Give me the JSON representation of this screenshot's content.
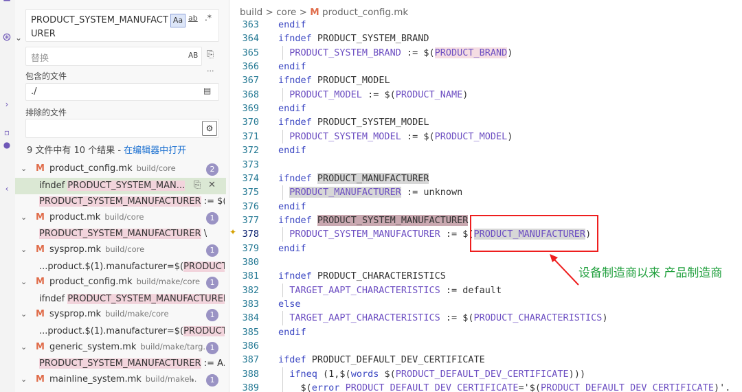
{
  "search": {
    "query": "PRODUCT_SYSTEM_MANUFACTURER",
    "option_case": "Aa",
    "option_word": "ab",
    "option_regex": ".*",
    "replace_placeholder": "替换",
    "replace_option": "AB",
    "include_label": "包含的文件",
    "include_value": "./",
    "exclude_label": "排除的文件",
    "exclude_value": "",
    "summary": "9 文件中有 10 个结果 - ",
    "open_in_editor": "在编辑器中打开",
    "more": "···"
  },
  "results": [
    {
      "file": "product_config.mk",
      "path": "build/core",
      "count": "2",
      "matches": [
        {
          "pre": "ifndef ",
          "hit": "PRODUCT_SYSTEM_MAN...",
          "post": ""
        },
        {
          "pre": "",
          "hit": "PRODUCT_SYSTEM_MANUFACTURER",
          "post": " := $(..."
        }
      ]
    },
    {
      "file": "product.mk",
      "path": "build/core",
      "count": "1",
      "matches": [
        {
          "pre": "",
          "hit": "PRODUCT_SYSTEM_MANUFACTURER",
          "post": " \\"
        }
      ]
    },
    {
      "file": "sysprop.mk",
      "path": "build/core",
      "count": "1",
      "matches": [
        {
          "pre": "...product.$(1).manufacturer=$(",
          "hit": "PRODUCT_...",
          "post": ""
        }
      ]
    },
    {
      "file": "product_config.mk",
      "path": "build/make/core",
      "count": "1",
      "matches": [
        {
          "pre": "ifndef ",
          "hit": "PRODUCT_SYSTEM_MANUFACTURER",
          "post": ""
        }
      ]
    },
    {
      "file": "sysprop.mk",
      "path": "build/make/core",
      "count": "1",
      "matches": [
        {
          "pre": "...product.$(1).manufacturer=$(",
          "hit": "PRODUCT_...",
          "post": ""
        }
      ]
    },
    {
      "file": "generic_system.mk",
      "path": "build/make/targ...",
      "count": "1",
      "matches": [
        {
          "pre": "",
          "hit": "PRODUCT_SYSTEM_MANUFACTURER",
          "post": " := A..."
        }
      ]
    },
    {
      "file": "mainline_system.mk",
      "path": "build/make...",
      "count": "1",
      "matches": []
    }
  ],
  "breadcrumb": {
    "part1": "build",
    "part2": "core",
    "file": "product_config.mk",
    "m": "M",
    "sep": ">"
  },
  "code_lines": [
    {
      "n": "363",
      "segs": [
        [
          "kw",
          "endif"
        ]
      ]
    },
    {
      "n": "364",
      "segs": [
        [
          "kw",
          "ifndef"
        ],
        [
          "",
          " PRODUCT_SYSTEM_BRAND"
        ]
      ]
    },
    {
      "n": "365",
      "segs": [
        [
          "",
          "  "
        ],
        [
          "var",
          "PRODUCT_SYSTEM_BRAND"
        ],
        [
          "",
          " := $("
        ],
        [
          "var pink",
          "PRODUCT_BRAND"
        ],
        [
          "",
          ")"
        ]
      ]
    },
    {
      "n": "366",
      "segs": [
        [
          "kw",
          "endif"
        ]
      ]
    },
    {
      "n": "367",
      "segs": [
        [
          "kw",
          "ifndef"
        ],
        [
          "",
          " PRODUCT_MODEL"
        ]
      ]
    },
    {
      "n": "368",
      "segs": [
        [
          "",
          "  "
        ],
        [
          "var",
          "PRODUCT_MODEL"
        ],
        [
          "",
          " := $("
        ],
        [
          "var",
          "PRODUCT_NAME"
        ],
        [
          "",
          ")"
        ]
      ]
    },
    {
      "n": "369",
      "segs": [
        [
          "kw",
          "endif"
        ]
      ]
    },
    {
      "n": "370",
      "segs": [
        [
          "kw",
          "ifndef"
        ],
        [
          "",
          " PRODUCT_SYSTEM_MODEL"
        ]
      ]
    },
    {
      "n": "371",
      "segs": [
        [
          "",
          "  "
        ],
        [
          "var",
          "PRODUCT_SYSTEM_MODEL"
        ],
        [
          "",
          " := $("
        ],
        [
          "var",
          "PRODUCT_MODEL"
        ],
        [
          "",
          ")"
        ]
      ]
    },
    {
      "n": "372",
      "segs": [
        [
          "kw",
          "endif"
        ]
      ]
    },
    {
      "n": "373",
      "segs": []
    },
    {
      "n": "374",
      "segs": [
        [
          "kw",
          "ifndef"
        ],
        [
          "",
          " "
        ],
        [
          "sel",
          "PRODUCT_MANUFACTURER"
        ]
      ]
    },
    {
      "n": "375",
      "segs": [
        [
          "",
          "  "
        ],
        [
          "var sel",
          "PRODUCT_MANUFACTURER"
        ],
        [
          "",
          " := unknown"
        ]
      ]
    },
    {
      "n": "376",
      "segs": [
        [
          "kw",
          "endif"
        ]
      ]
    },
    {
      "n": "377",
      "segs": [
        [
          "kw",
          "ifndef"
        ],
        [
          "",
          " "
        ],
        [
          "sel2",
          "PRODUCT_SYSTEM_MANUFACTURER"
        ]
      ]
    },
    {
      "n": "378",
      "cur": true,
      "segs": [
        [
          "",
          "  "
        ],
        [
          "var",
          "PRODUCT_SYSTEM_MANUFACTURER"
        ],
        [
          "",
          " := $("
        ],
        [
          "var sel",
          "PRODUCT_MANUFACTURER"
        ],
        [
          "",
          ")"
        ]
      ]
    },
    {
      "n": "379",
      "segs": [
        [
          "kw",
          "endif"
        ]
      ]
    },
    {
      "n": "380",
      "segs": []
    },
    {
      "n": "381",
      "segs": [
        [
          "kw",
          "ifndef"
        ],
        [
          "",
          " PRODUCT_CHARACTERISTICS"
        ]
      ]
    },
    {
      "n": "382",
      "segs": [
        [
          "",
          "  "
        ],
        [
          "var",
          "TARGET_AAPT_CHARACTERISTICS"
        ],
        [
          "",
          " := default"
        ]
      ]
    },
    {
      "n": "383",
      "segs": [
        [
          "kw",
          "else"
        ]
      ]
    },
    {
      "n": "384",
      "segs": [
        [
          "",
          "  "
        ],
        [
          "var",
          "TARGET_AAPT_CHARACTERISTICS"
        ],
        [
          "",
          " := $("
        ],
        [
          "var",
          "PRODUCT_CHARACTERISTICS"
        ],
        [
          "",
          ")"
        ]
      ]
    },
    {
      "n": "385",
      "segs": [
        [
          "kw",
          "endif"
        ]
      ]
    },
    {
      "n": "386",
      "segs": []
    },
    {
      "n": "387",
      "segs": [
        [
          "kw",
          "ifdef"
        ],
        [
          "",
          " PRODUCT_DEFAULT_DEV_CERTIFICATE"
        ]
      ]
    },
    {
      "n": "388",
      "segs": [
        [
          "",
          "  "
        ],
        [
          "kw",
          "ifneq"
        ],
        [
          "",
          " (1,$("
        ],
        [
          "kw",
          "words"
        ],
        [
          "",
          " $("
        ],
        [
          "var",
          "PRODUCT_DEFAULT_DEV_CERTIFICATE"
        ],
        [
          "",
          ")))"
        ]
      ]
    },
    {
      "n": "389",
      "segs": [
        [
          "",
          "    $("
        ],
        [
          "kw",
          "error"
        ],
        [
          "",
          " "
        ],
        [
          "var",
          "PRODUCT_DEFAULT_DEV_CERTIFICATE"
        ],
        [
          "",
          "='$("
        ],
        [
          "var",
          "PRODUCT_DEFAULT_DEV_CERTIFICATE"
        ],
        [
          "",
          ")'."
        ]
      ]
    }
  ],
  "annotation": "设备制造商以来 产品制造商",
  "colors": {
    "accent": "#3a46c2",
    "annotation": "#1f9f3c",
    "box": "#ee1e1e",
    "badge": "#9a93c4"
  }
}
